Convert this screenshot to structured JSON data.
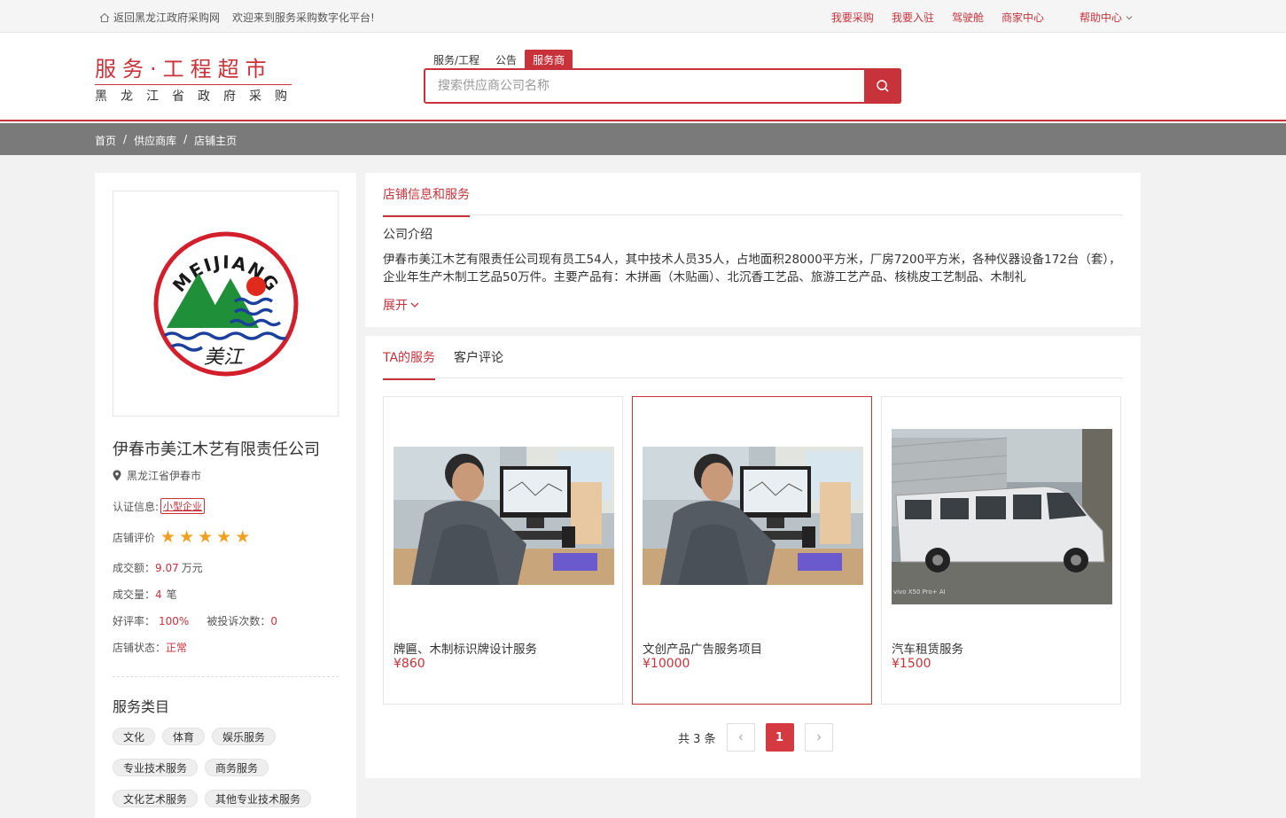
{
  "topbar": {
    "back_link": "返回黑龙江政府采购网",
    "welcome": "欢迎来到服务采购数字化平台!",
    "links": [
      "我要采购",
      "我要入驻",
      "驾驶舱",
      "商家中心"
    ],
    "help": "帮助中心"
  },
  "logo": {
    "line1": "服务·工程超市",
    "line2": "黑龙江省政府采购"
  },
  "search": {
    "tabs": [
      "服务/工程",
      "公告",
      "服务商"
    ],
    "active_tab": "服务商",
    "placeholder": "搜索供应商公司名称"
  },
  "breadcrumb": [
    "首页",
    "供应商库",
    "店铺主页"
  ],
  "shop": {
    "logo_text": "MEIJIANG",
    "logo_script": "美江",
    "name": "伊春市美江木艺有限责任公司",
    "location": "黑龙江省伊春市",
    "cert_label": "认证信息:",
    "cert_value": "小型企业",
    "rating_label": "店铺评价",
    "rating": 5,
    "amount_label": "成交额：",
    "amount_value": "9.07",
    "amount_unit": "万元",
    "count_label": "成交量：",
    "count_value": "4",
    "count_unit": "笔",
    "good_label": "好评率：",
    "good_value": "100%",
    "complaint_label": "被投诉次数：",
    "complaint_value": "0",
    "status_label": "店铺状态：",
    "status_value": "正常"
  },
  "categories": {
    "title": "服务类目",
    "items": [
      "文化",
      "体育",
      "娱乐服务",
      "专业技术服务",
      "商务服务",
      "文化艺术服务",
      "其他专业技术服务"
    ]
  },
  "info_panel": {
    "tab": "店铺信息和服务",
    "intro_title": "公司介绍",
    "intro_text": "伊春市美江木艺有限责任公司现有员工54人，其中技术人员35人，占地面积28000平方米，厂房7200平方米，各种仪器设备172台（套），企业年生产木制工艺品50万件。主要产品有：木拼画（木贴画）、北沉香工艺品、旅游工艺产品、核桃皮工艺制品、木制礼",
    "expand": "展开"
  },
  "services_panel": {
    "tabs": [
      "TA的服务",
      "客户评论"
    ],
    "active_tab": "TA的服务",
    "cards": [
      {
        "title": "牌匾、木制标识牌设计服务",
        "price": "¥860",
        "image": "worker-at-computer-photo"
      },
      {
        "title": "文创产品广告服务项目",
        "price": "¥10000",
        "image": "worker-at-computer-photo"
      },
      {
        "title": "汽车租赁服务",
        "price": "¥1500",
        "image": "white-van-photo",
        "watermark": "vivo X50 Pro+ AI"
      }
    ],
    "pager": {
      "total": "共 3 条",
      "current": "1"
    }
  },
  "colors": {
    "brand": "#c8323a",
    "star": "#f0a020",
    "breadcrumb_bg": "#7a7a7a"
  }
}
